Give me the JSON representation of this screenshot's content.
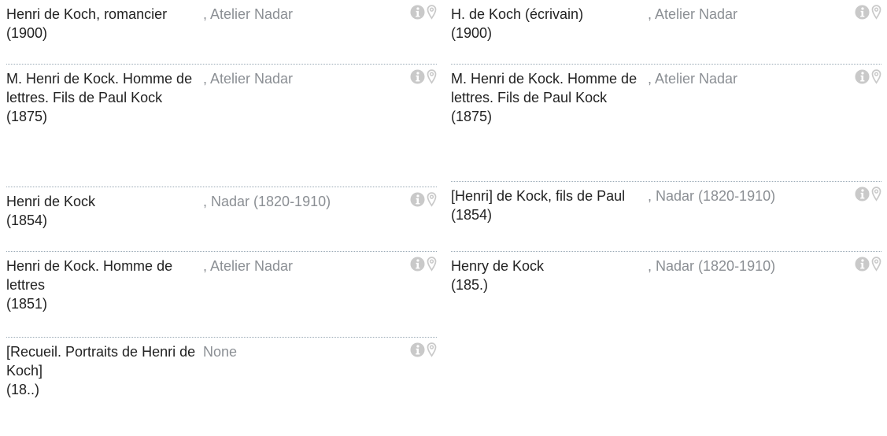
{
  "left_column": [
    {
      "title": "Henri de Koch, romancier",
      "date": "(1900)",
      "author": ", Atelier Nadar"
    },
    {
      "title": "M. Henri de Kock. Homme de lettres. Fils de Paul Kock",
      "date": "(1875)",
      "author": ", Atelier Nadar"
    },
    {
      "title": "Henri de Kock",
      "date": "(1854)",
      "author": ", Nadar (1820-1910)"
    },
    {
      "title": "Henri de Kock. Homme de lettres",
      "date": "(1851)",
      "author": ", Atelier Nadar"
    },
    {
      "title": "[Recueil. Portraits de Henri de Koch]",
      "date": "(18..)",
      "author": "None"
    }
  ],
  "right_column": [
    {
      "title": "H. de Koch (écrivain)",
      "date": "(1900)",
      "author": ", Atelier Nadar"
    },
    {
      "title": "M. Henri de Kock. Homme de lettres. Fils de Paul Kock",
      "date": "(1875)",
      "author": ", Atelier Nadar"
    },
    {
      "title": "[Henri] de Kock, fils de Paul",
      "date": "(1854)",
      "author": ", Nadar (1820-1910)"
    },
    {
      "title": "Henry de Kock",
      "date": "(185.)",
      "author": ", Nadar (1820-1910)"
    }
  ],
  "icons": {
    "info": "info-circle-icon",
    "location": "map-marker-icon"
  },
  "colors": {
    "title": "#222222",
    "author": "#8b8f94",
    "icon": "#c9c9c9",
    "divider": "#9aa9b5"
  }
}
